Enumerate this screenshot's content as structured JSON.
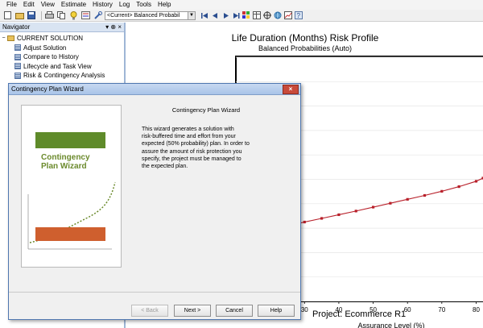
{
  "menu": [
    "File",
    "Edit",
    "View",
    "Estimate",
    "History",
    "Log",
    "Tools",
    "Help"
  ],
  "toolbar": {
    "solution_select": "<Current>  Balanced Probabil",
    "icons": [
      "new-icon",
      "open-icon",
      "save-icon",
      "print-icon",
      "copy-icon",
      "lightbulb-icon",
      "options-icon",
      "wrench-icon"
    ],
    "nav_icons": [
      "first-icon",
      "prev-icon",
      "play-icon",
      "next-icon",
      "last-icon",
      "grid-icon",
      "table-icon",
      "target-icon",
      "globe-icon",
      "chart-tool-icon",
      "help-icon"
    ]
  },
  "navigator": {
    "title": "Navigator",
    "pin_glyph": "▾ ⊕ ×",
    "root": "CURRENT SOLUTION",
    "items": [
      "Adjust Solution",
      "Compare to History",
      "Lifecycle and Task View",
      "Risk & Contingency Analysis"
    ]
  },
  "chart": {
    "title": "Life Duration (Months) Risk Profile",
    "subtitle": "Balanced Probabilities (Auto)",
    "xlabel": "Assurance Level (%)",
    "project": "Project: Ecommerce R1"
  },
  "chart_data": {
    "type": "line",
    "title": "Life Duration (Months) Risk Profile",
    "subtitle": "Balanced Probabilities (Auto)",
    "xlabel": "Assurance Level (%)",
    "ylabel": "",
    "xlim": [
      10,
      82
    ],
    "x_ticks": [
      30,
      40,
      50,
      60,
      70,
      80
    ],
    "x_tick_labels": [
      "30",
      "40",
      "50",
      "60",
      "70",
      "80"
    ],
    "series": [
      {
        "color": "#b8202a",
        "x": [
          25,
          30,
          35,
          40,
          45,
          50,
          55,
          60,
          65,
          70,
          75,
          80,
          82
        ],
        "y": [
          0.31,
          0.325,
          0.34,
          0.355,
          0.37,
          0.386,
          0.402,
          0.418,
          0.434,
          0.451,
          0.47,
          0.492,
          0.505
        ]
      }
    ],
    "grid": true
  },
  "dialog": {
    "title": "Contingency Plan Wizard",
    "close_glyph": "×",
    "heading": "Contingency Plan Wizard",
    "body": "This wizard generates a solution with\nrisk-buffered time and effort from your\nexpected (50% probability) plan.  In order to\nassure the amount of risk protection you\nspecify, the project must be managed to\nthe expected plan.",
    "image_text_1": "Contingency",
    "image_text_2": "Plan Wizard",
    "buttons": {
      "back": "< Back",
      "next": "Next >",
      "cancel": "Cancel",
      "help": "Help"
    }
  }
}
